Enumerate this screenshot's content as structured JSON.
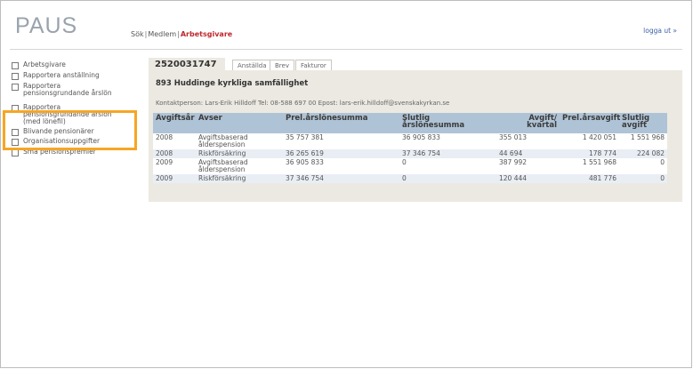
{
  "header": {
    "logo": "PAUS",
    "nav": [
      {
        "label": "Sök"
      },
      {
        "label": "Medlem"
      },
      {
        "label": "Arbetsgivare"
      }
    ],
    "logout": "logga ut »"
  },
  "sidebar": {
    "items": [
      {
        "label": "Arbetsgivare"
      },
      {
        "label": "Rapportera anställning"
      },
      {
        "label": "Rapportera\npensionsgrundande årslön"
      },
      {
        "label": "Rapportera\npensionsgrundande årslön\n(med lönefil)"
      },
      {
        "label": "Blivande pensionärer"
      },
      {
        "label": "Organisationsuppgifter"
      },
      {
        "label": "Små pensionspremier"
      }
    ]
  },
  "main": {
    "org_number": "2520031747",
    "tabs": [
      {
        "label": "Anställda"
      },
      {
        "label": "Brev"
      },
      {
        "label": "Fakturor"
      }
    ],
    "org_name": "893 Huddinge kyrkliga samfällighet",
    "contact": "Kontaktperson: Lars-Erik Hilldoff Tel: 08-588 697 00 Epost: lars-erik.hilldoff@svenskakyrkan.se",
    "table": {
      "headers": [
        "Avgiftsår",
        "Avser",
        "Prel.årslönesumma",
        "Slutlig årslönesumma",
        "Avgift/ kvartal",
        "Prel.årsavgift",
        "Slutlig avgift"
      ],
      "rows": [
        [
          "2008",
          "Avgiftsbaserad ålderspension",
          "35 757 381",
          "36 905 833",
          "355 013",
          "1 420 051",
          "1 551 968"
        ],
        [
          "2008",
          "Riskförsäkring",
          "36 265 619",
          "37 346 754",
          "44 694",
          "178 774",
          "224 082"
        ],
        [
          "2009",
          "Avgiftsbaserad ålderspension",
          "36 905 833",
          "0",
          "387 992",
          "1 551 968",
          "0"
        ],
        [
          "2009",
          "Riskförsäkring",
          "37 346 754",
          "0",
          "120 444",
          "481 776",
          "0"
        ]
      ]
    }
  }
}
